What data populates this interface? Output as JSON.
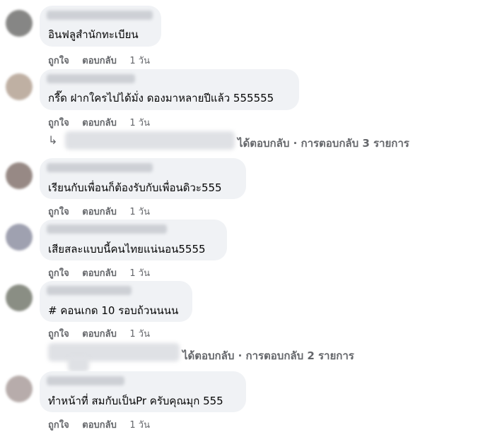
{
  "actions": {
    "like": "ถูกใจ",
    "reply": "ตอบกลับ"
  },
  "comments": [
    {
      "text": "อินฟลูสำนักทะเบียน",
      "time": "1 วัน",
      "avatar_color": "#7a7a78"
    },
    {
      "text": "กรี๊ด ฝากใครไปได้มั่ง ดองมาหลายปีแล้ว 555555",
      "time": "1 วัน",
      "avatar_color": "#b9a89a"
    },
    {
      "text": "เรียนกับเพื่อนก็ต้องรับกับเพื่อนดิวะ555",
      "time": "1 วัน",
      "avatar_color": "#8c7d78"
    },
    {
      "text": "เสียสละแบบนี้คนไทยแน่นอน5555",
      "time": "1 วัน",
      "avatar_color": "#9597a8"
    },
    {
      "text": "# คอนเกด 10 รอบถ้วนนนน",
      "time": "1 วัน",
      "avatar_color": "#7e8277"
    },
    {
      "text": "ทำหน้าที่ สมกับเป็นPr ครับคุณมุก 555",
      "time": "1 วัน",
      "avatar_color": "#b0a4a2"
    }
  ],
  "replies": [
    {
      "text": "ได้ตอบกลับ · การตอบกลับ 3 รายการ"
    },
    {
      "text": "ได้ตอบกลับ · การตอบกลับ 2 รายการ"
    }
  ]
}
